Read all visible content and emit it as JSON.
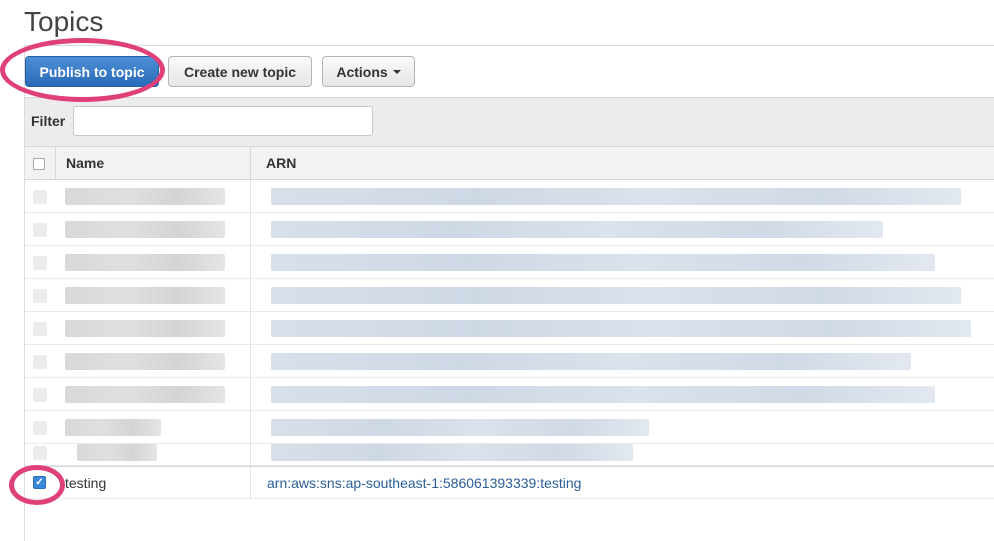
{
  "page": {
    "title": "Topics"
  },
  "toolbar": {
    "publish_label": "Publish to topic",
    "create_label": "Create new topic",
    "actions_label": "Actions"
  },
  "filter": {
    "label": "Filter",
    "value": "",
    "placeholder": ""
  },
  "table": {
    "columns": [
      "Name",
      "ARN"
    ],
    "visible_row": {
      "name": "testing",
      "arn": "arn:aws:sns:ap-southeast-1:586061393339:testing",
      "checked": true
    }
  },
  "colors": {
    "primary": "#2a6bb8",
    "link": "#2a5f99",
    "highlight": "#e0407a"
  }
}
